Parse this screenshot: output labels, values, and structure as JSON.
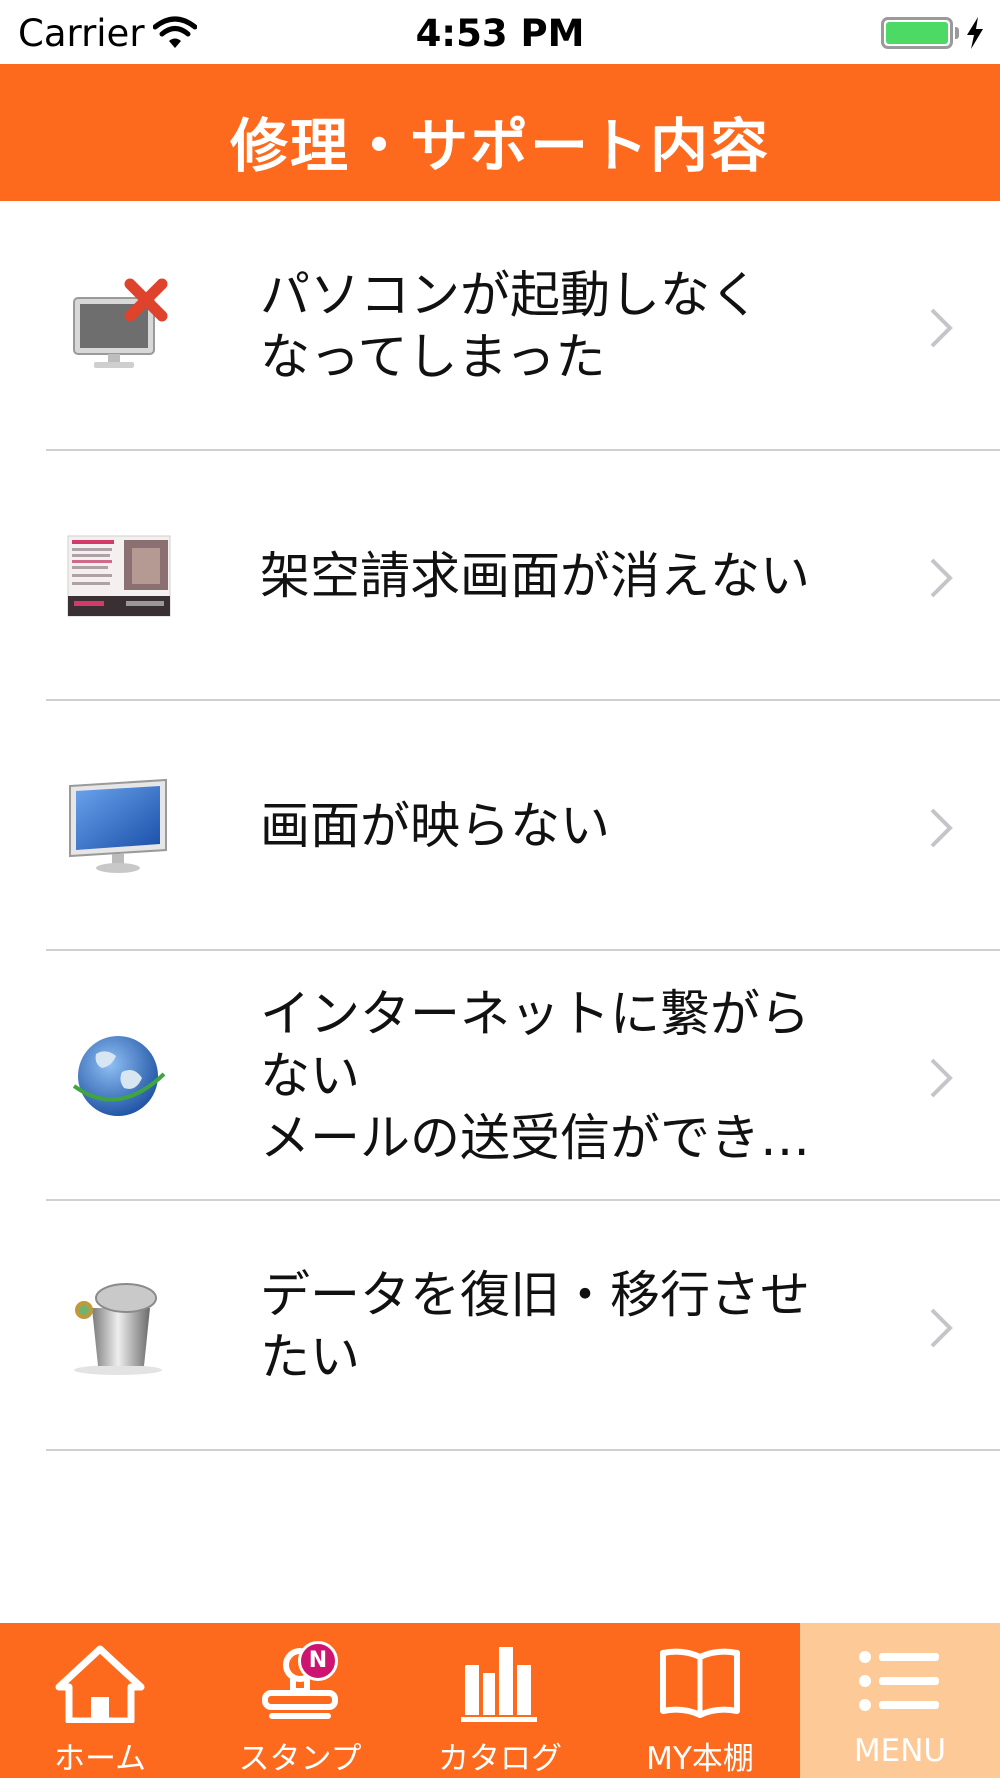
{
  "status_bar": {
    "carrier": "Carrier",
    "time": "4:53 PM",
    "battery_color": "#4cd964"
  },
  "header": {
    "title": "修理・サポート内容",
    "background": "#fd6a1d"
  },
  "list": {
    "items": [
      {
        "label": "パソコンが起動しなく\nなってしまった",
        "icon": "pc-error-icon"
      },
      {
        "label": "架空請求画面が消えない",
        "icon": "fake-billing-screen-icon"
      },
      {
        "label": "画面が映らない",
        "icon": "monitor-icon"
      },
      {
        "label": "インターネットに繋がら\nない\nメールの送受信ができ…",
        "icon": "globe-icon"
      },
      {
        "label": "データを復旧・移行させ\nたい",
        "icon": "trash-can-icon"
      }
    ]
  },
  "tab_bar": {
    "tabs": [
      {
        "label": "ホーム",
        "icon": "home-icon"
      },
      {
        "label": "スタンプ",
        "icon": "stamp-icon",
        "badge": "N"
      },
      {
        "label": "カタログ",
        "icon": "catalog-icon"
      },
      {
        "label": "MY本棚",
        "icon": "book-icon"
      },
      {
        "label": "MENU",
        "icon": "menu-icon",
        "active": true
      }
    ],
    "active_background": "#fdc997"
  }
}
